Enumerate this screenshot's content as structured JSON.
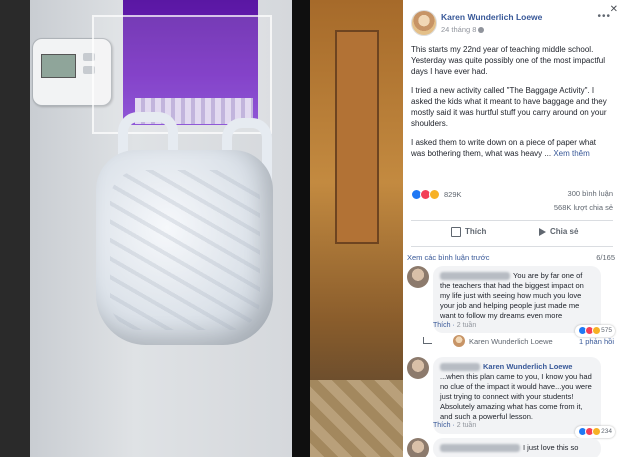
{
  "post": {
    "author": "Karen Wunderlich Loewe",
    "date": "24 tháng 8",
    "paragraphs": [
      "This starts my 22nd year of teaching middle school. Yesterday was quite possibly one of the most impactful days I have ever had.",
      "I tried a new activity called \"The Baggage Activity\". I asked the kids what it meant to have baggage and they mostly said it was hurtful stuff you carry around on your shoulders.",
      "I asked them to write down on a piece of paper what was bothering them, what was heavy ..."
    ],
    "see_more": "Xem thêm"
  },
  "stats": {
    "reactions": "829K",
    "comments": "300 bình luận",
    "shares": "568K lượt chia sẻ"
  },
  "actions": {
    "like": "Thích",
    "share": "Chia sẻ"
  },
  "comments_bar": {
    "previous": "Xem các bình luận trước",
    "pager": "6/165"
  },
  "comments": [
    {
      "text": "You are by far one of the teachers that had the biggest impact on my life just with seeing how much you love your job and helping people just made me want to follow my dreams even more",
      "reaction_count": "575",
      "like": "Thích",
      "age": "2 tuần"
    },
    {
      "author": "Karen Wunderlich Loewe",
      "text": "...when this plan came to you, I know you had no clue of the impact it would have...you were just trying to connect with your students! Absolutely amazing what has come from it, and such a powerful lesson.",
      "reaction_count": "234",
      "like": "Thích",
      "age": "2 tuần"
    },
    {
      "text": "I just love this so"
    }
  ],
  "reply": {
    "author": "Karen Wunderlich Loewe",
    "count": "1 phản hồi"
  },
  "icons": [
    "more-options-icon",
    "close-icon",
    "globe-icon",
    "like-icon",
    "share-icon",
    "reply-arrow-icon"
  ],
  "colors": {
    "link": "#385898",
    "like": "#2078f4",
    "love": "#f33e58",
    "wow": "#f7b125",
    "bag_purple": "#6f22c0"
  }
}
